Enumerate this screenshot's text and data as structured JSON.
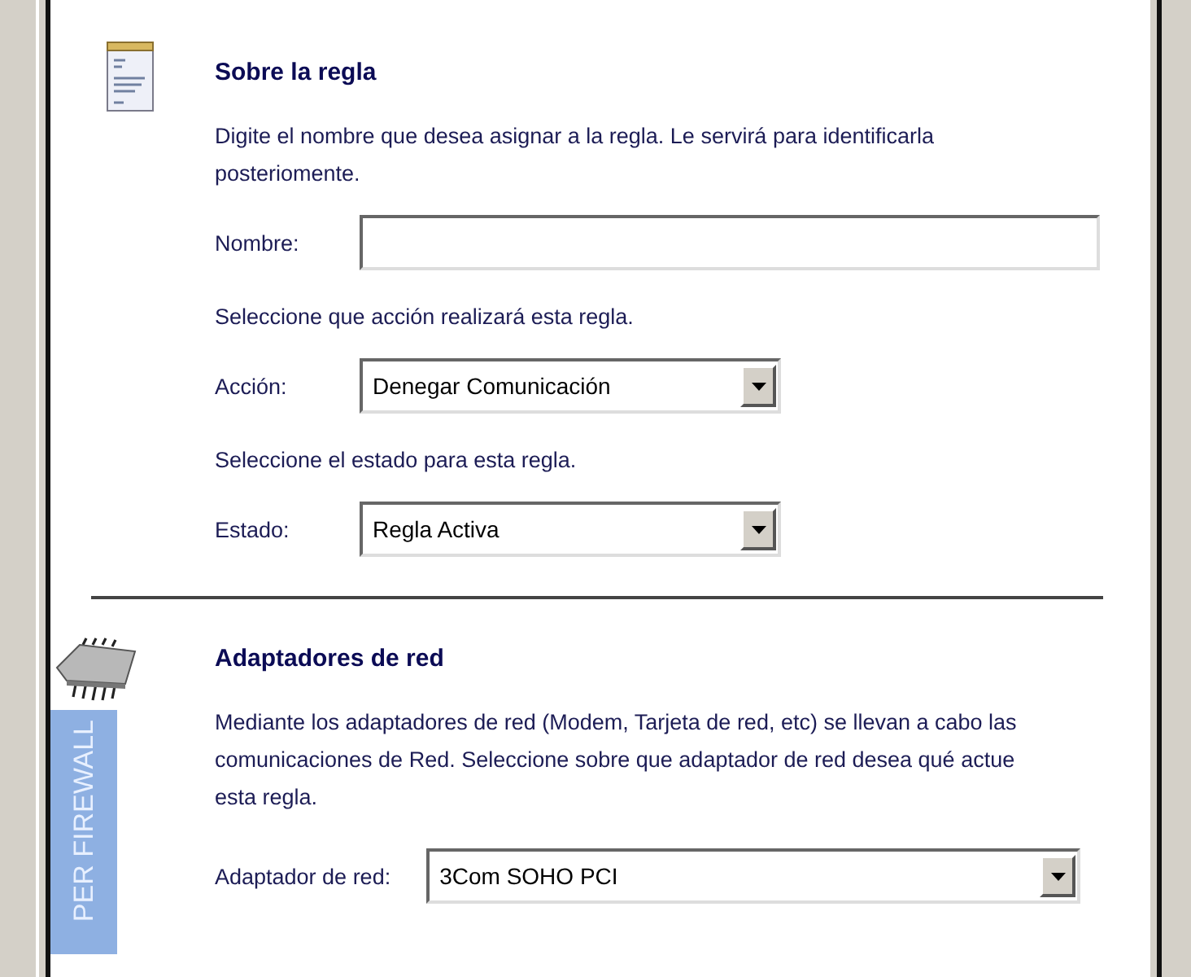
{
  "sections": [
    {
      "kind": "rule",
      "title": "Sobre la regla",
      "description": "Digite el nombre que desea asignar a la regla. Le servirá para identificarla posteriomente.",
      "fields": [
        {
          "kind": "text",
          "label": "Nombre:"
        },
        {
          "kind": "note",
          "text": "Seleccione que acción realizará esta regla."
        },
        {
          "kind": "dropdown",
          "label": "Acción:",
          "value": "Denegar Comunicación"
        },
        {
          "kind": "note",
          "text": "Seleccione el estado para esta regla."
        },
        {
          "kind": "dropdown",
          "label": "Estado:",
          "value": "Regla Activa"
        }
      ]
    },
    {
      "kind": "network",
      "title": "Adaptadores de red",
      "description": "Mediante los adaptadores de red (Modem, Tarjeta de red, etc) se llevan a cabo las comunicaciones de Red. Seleccione sobre que adaptador de red desea qué actue esta regla.",
      "fields": [
        {
          "kind": "dropdown",
          "label": "Adaptador de red:",
          "value": "3Com SOHO PCI"
        }
      ]
    }
  ],
  "banner": {
    "text": "PER FIREWALL"
  }
}
